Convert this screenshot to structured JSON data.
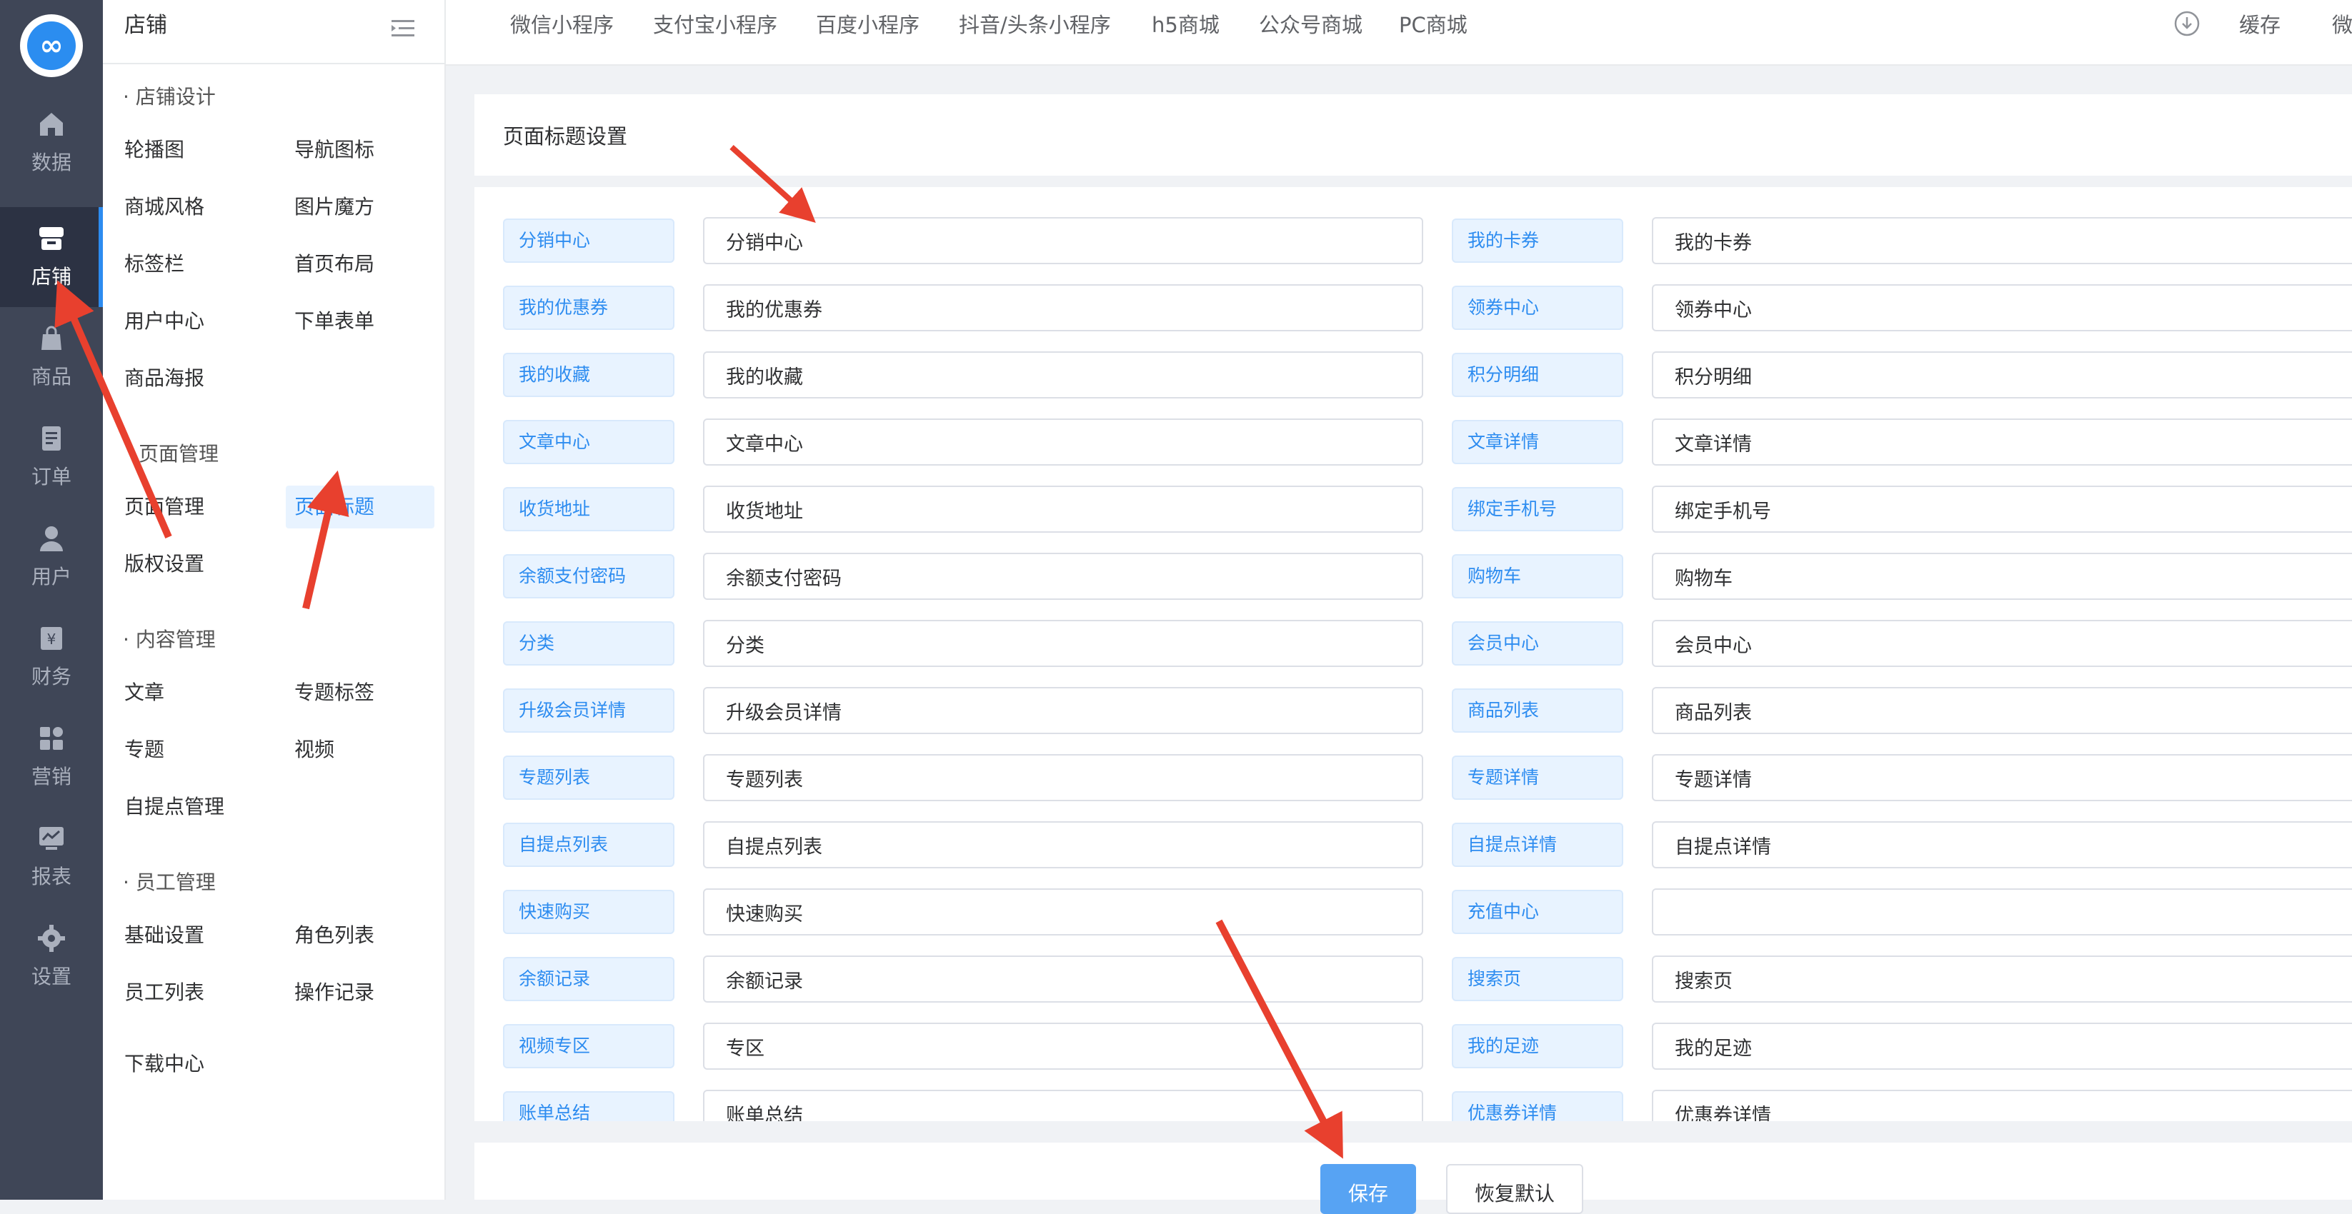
{
  "rail": {
    "items": [
      {
        "label": "数据",
        "icon": "home-icon"
      },
      {
        "label": "店铺",
        "icon": "store-icon",
        "active": true
      },
      {
        "label": "商品",
        "icon": "bag-icon"
      },
      {
        "label": "订单",
        "icon": "document-icon"
      },
      {
        "label": "用户",
        "icon": "user-icon"
      },
      {
        "label": "财务",
        "icon": "yuan-icon"
      },
      {
        "label": "营销",
        "icon": "grid-icon"
      },
      {
        "label": "报表",
        "icon": "chart-icon"
      },
      {
        "label": "设置",
        "icon": "gear-icon"
      }
    ]
  },
  "submenu": {
    "title": "店铺",
    "groups": [
      {
        "title": "· 店铺设计",
        "items": [
          "轮播图",
          "导航图标",
          "商城风格",
          "图片魔方",
          "标签栏",
          "首页布局",
          "用户中心",
          "下单表单",
          "商品海报"
        ]
      },
      {
        "title": "页面管理",
        "items": [
          "页面管理",
          "页面标题",
          "版权设置"
        ]
      },
      {
        "title": "· 内容管理",
        "items": [
          "文章",
          "专题标签",
          "专题",
          "视频",
          "自提点管理"
        ]
      },
      {
        "title": "· 员工管理",
        "items": [
          "基础设置",
          "角色列表",
          "员工列表",
          "操作记录"
        ]
      },
      {
        "title": "",
        "items": [
          "下载中心"
        ]
      }
    ],
    "selected": "页面标题"
  },
  "topbar": {
    "tabs": [
      "微信小程序",
      "支付宝小程序",
      "百度小程序",
      "抖音/头条小程序",
      "h5商城",
      "公众号商城",
      "PC商城"
    ],
    "cache_label": "缓存",
    "cut_label": "微"
  },
  "card": {
    "title": "页面标题设置"
  },
  "fields_left": [
    {
      "label": "分销中心",
      "value": "分销中心"
    },
    {
      "label": "我的优惠券",
      "value": "我的优惠券"
    },
    {
      "label": "我的收藏",
      "value": "我的收藏"
    },
    {
      "label": "文章中心",
      "value": "文章中心"
    },
    {
      "label": "收货地址",
      "value": "收货地址"
    },
    {
      "label": "余额支付密码",
      "value": "余额支付密码"
    },
    {
      "label": "分类",
      "value": "分类"
    },
    {
      "label": "升级会员详情",
      "value": "升级会员详情"
    },
    {
      "label": "专题列表",
      "value": "专题列表"
    },
    {
      "label": "自提点列表",
      "value": "自提点列表"
    },
    {
      "label": "快速购买",
      "value": "快速购买"
    },
    {
      "label": "余额记录",
      "value": "余额记录"
    },
    {
      "label": "视频专区",
      "value": "专区"
    },
    {
      "label": "账单总结",
      "value": "账单总结"
    }
  ],
  "fields_right": [
    {
      "label": "我的卡券",
      "value": "我的卡券"
    },
    {
      "label": "领券中心",
      "value": "领券中心"
    },
    {
      "label": "积分明细",
      "value": "积分明细"
    },
    {
      "label": "文章详情",
      "value": "文章详情"
    },
    {
      "label": "绑定手机号",
      "value": "绑定手机号"
    },
    {
      "label": "购物车",
      "value": "购物车"
    },
    {
      "label": "会员中心",
      "value": "会员中心"
    },
    {
      "label": "商品列表",
      "value": "商品列表"
    },
    {
      "label": "专题详情",
      "value": "专题详情"
    },
    {
      "label": "自提点详情",
      "value": "自提点详情"
    },
    {
      "label": "充值中心",
      "value": ""
    },
    {
      "label": "搜索页",
      "value": "搜索页"
    },
    {
      "label": "我的足迹",
      "value": "我的足迹"
    },
    {
      "label": "优惠券详情",
      "value": "优惠券详情"
    }
  ],
  "buttons": {
    "save": "保存",
    "reset": "恢复默认"
  },
  "colors": {
    "accent": "#2d8cf0",
    "rail_bg": "#3f4657",
    "arrow": "#e8402e"
  }
}
